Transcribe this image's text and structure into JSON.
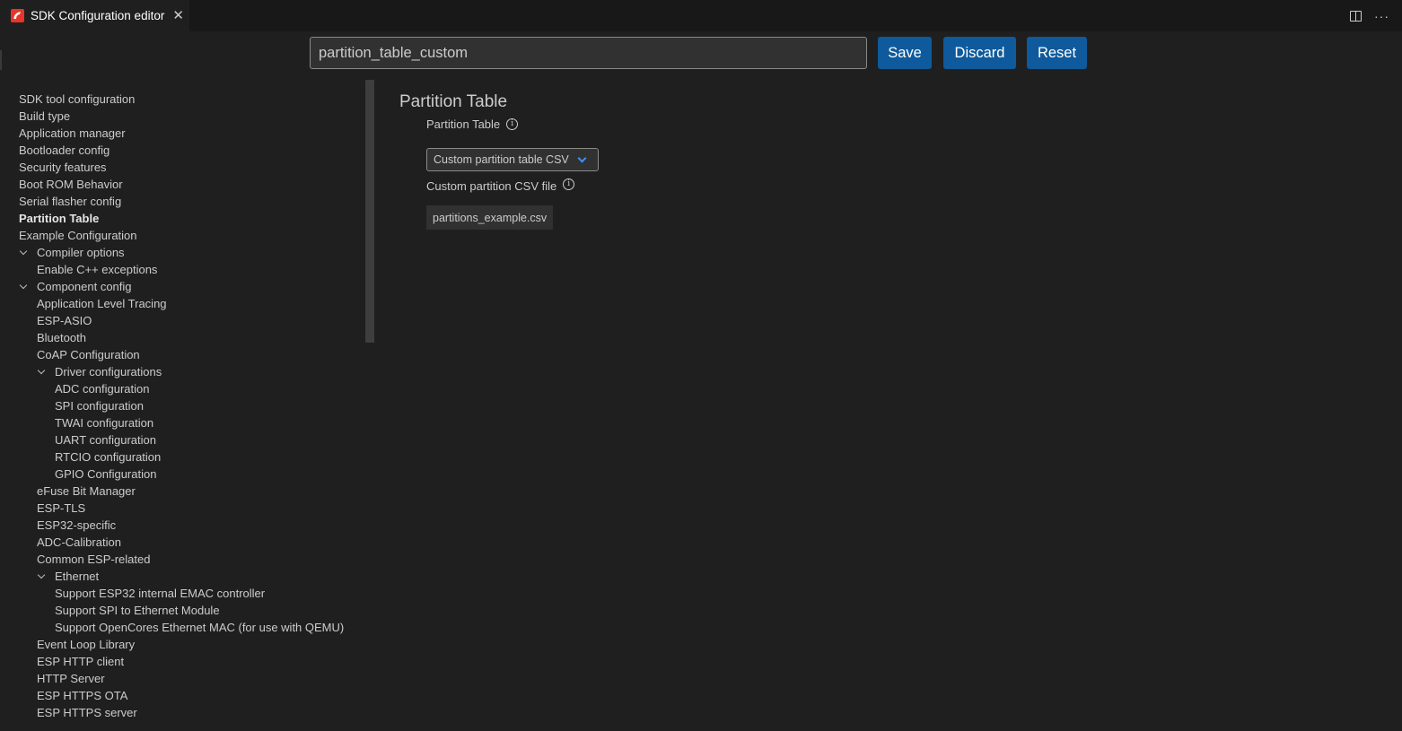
{
  "tab": {
    "title": "SDK Configuration editor",
    "close_icon": "close-icon",
    "logo_icon": "espressif-logo-icon"
  },
  "tab_actions": {
    "split_icon": "split-editor-icon",
    "more_icon": "more-actions-icon",
    "more_glyph": "···"
  },
  "toolbar": {
    "search_value": "partition_table_custom",
    "save_label": "Save",
    "discard_label": "Discard",
    "reset_label": "Reset"
  },
  "sidebar": {
    "items": [
      {
        "label": "SDK tool configuration",
        "level": 0
      },
      {
        "label": "Build type",
        "level": 0
      },
      {
        "label": "Application manager",
        "level": 0
      },
      {
        "label": "Bootloader config",
        "level": 0
      },
      {
        "label": "Security features",
        "level": 0
      },
      {
        "label": "Boot ROM Behavior",
        "level": 0
      },
      {
        "label": "Serial flasher config",
        "level": 0
      },
      {
        "label": "Partition Table",
        "level": 0,
        "active": true
      },
      {
        "label": "Example Configuration",
        "level": 0
      },
      {
        "label": "Compiler options",
        "level": 1,
        "expanded": true
      },
      {
        "label": "Enable C++ exceptions",
        "level": 1
      },
      {
        "label": "Component config",
        "level": 1,
        "expanded": true
      },
      {
        "label": "Application Level Tracing",
        "level": 1
      },
      {
        "label": "ESP-ASIO",
        "level": 1
      },
      {
        "label": "Bluetooth",
        "level": 1
      },
      {
        "label": "CoAP Configuration",
        "level": 1
      },
      {
        "label": "Driver configurations",
        "level": 2,
        "expanded": true
      },
      {
        "label": "ADC configuration",
        "level": 2
      },
      {
        "label": "SPI configuration",
        "level": 2
      },
      {
        "label": "TWAI configuration",
        "level": 2
      },
      {
        "label": "UART configuration",
        "level": 2
      },
      {
        "label": "RTCIO configuration",
        "level": 2
      },
      {
        "label": "GPIO Configuration",
        "level": 2
      },
      {
        "label": "eFuse Bit Manager",
        "level": 1
      },
      {
        "label": "ESP-TLS",
        "level": 1
      },
      {
        "label": "ESP32-specific",
        "level": 1
      },
      {
        "label": "ADC-Calibration",
        "level": 1
      },
      {
        "label": "Common ESP-related",
        "level": 1
      },
      {
        "label": "Ethernet",
        "level": 2,
        "expanded": true
      },
      {
        "label": "Support ESP32 internal EMAC controller",
        "level": 2
      },
      {
        "label": "Support SPI to Ethernet Module",
        "level": 2
      },
      {
        "label": "Support OpenCores Ethernet MAC (for use with QEMU)",
        "level": 2
      },
      {
        "label": "Event Loop Library",
        "level": 1
      },
      {
        "label": "ESP HTTP client",
        "level": 1
      },
      {
        "label": "HTTP Server",
        "level": 1
      },
      {
        "label": "ESP HTTPS OTA",
        "level": 1
      },
      {
        "label": "ESP HTTPS server",
        "level": 1
      }
    ]
  },
  "content": {
    "section_title": "Partition Table",
    "fields": [
      {
        "label": "Partition Table",
        "type": "select",
        "value": "Custom partition table CSV"
      },
      {
        "label": "Custom partition CSV file",
        "type": "text",
        "value": "partitions_example.csv"
      }
    ],
    "info_glyph": "i"
  }
}
